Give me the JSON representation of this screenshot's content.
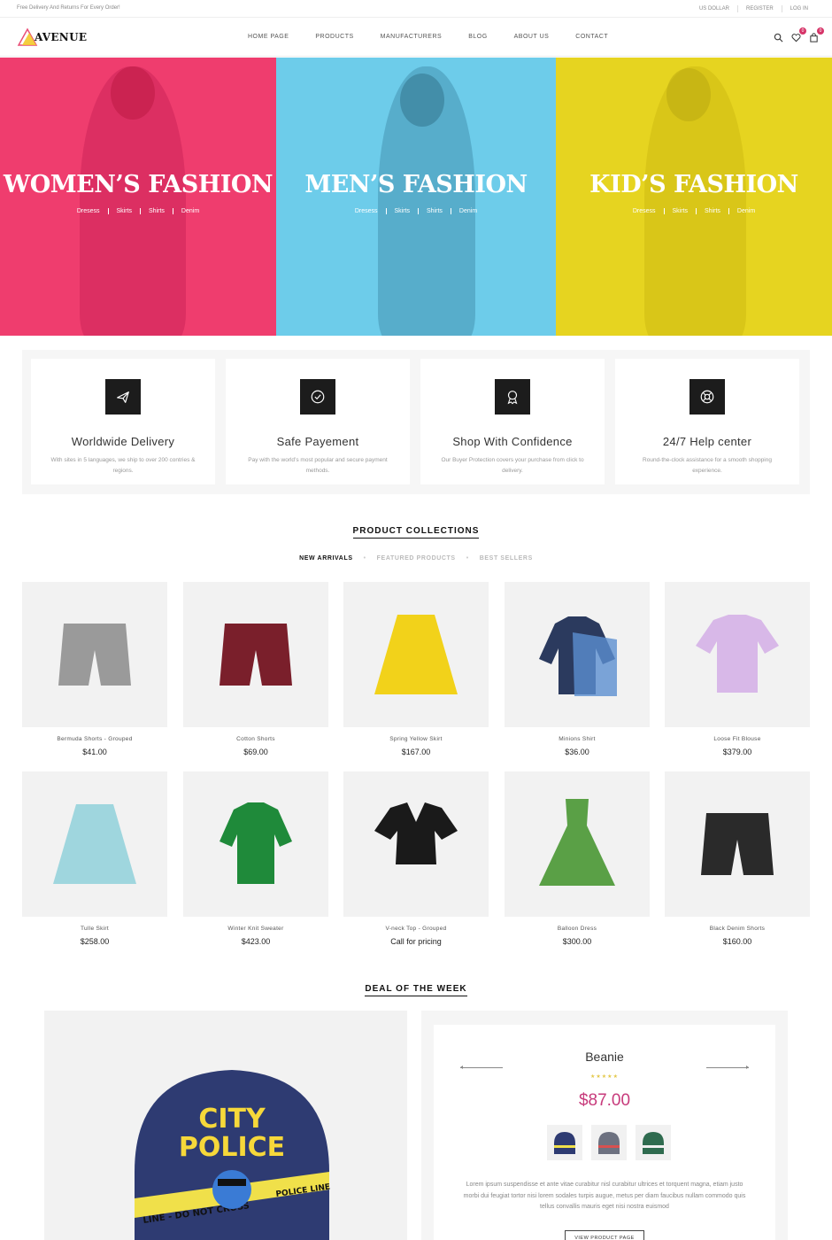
{
  "topbar": {
    "promo": "Free Delivery And Returns For Every Order!",
    "currency": "US DOLLAR",
    "register": "REGISTER",
    "login": "LOG IN"
  },
  "header": {
    "brand": "AVENUE",
    "nav": [
      "HOME PAGE",
      "PRODUCTS",
      "MANUFACTURERS",
      "BLOG",
      "ABOUT US",
      "CONTACT"
    ],
    "wishlist_count": "0",
    "cart_count": "0",
    "icons": [
      "search-icon",
      "heart-icon",
      "bag-icon"
    ]
  },
  "hero": [
    {
      "title": "WOMEN’S FASHION",
      "links": [
        "Dresess",
        "Skirts",
        "Shirts",
        "Denim"
      ],
      "color": "#ef3d6e"
    },
    {
      "title": "MEN’S FASHION",
      "links": [
        "Dresess",
        "Skirts",
        "Shirts",
        "Denim"
      ],
      "color": "#6dccea"
    },
    {
      "title": "KID’S FASHION",
      "links": [
        "Dresess",
        "Skirts",
        "Shirts",
        "Denim"
      ],
      "color": "#e6d420"
    }
  ],
  "features": [
    {
      "title": "Worldwide Delivery",
      "desc": "With sites in 5 languages, we ship to over 200 contries & regions.",
      "icon": "plane-icon"
    },
    {
      "title": "Safe Payement",
      "desc": "Pay with the world’s most popular and secure payment methods.",
      "icon": "check-circle-icon"
    },
    {
      "title": "Shop With Confidence",
      "desc": "Our Buyer Protection covers your purchase from click to delivery.",
      "icon": "award-icon"
    },
    {
      "title": "24/7 Help center",
      "desc": "Round-the-clock assistance for a smooth shopping experience.",
      "icon": "lifebuoy-icon"
    }
  ],
  "collections": {
    "title": "PRODUCT COLLECTIONS",
    "tabs": [
      "NEW ARRIVALS",
      "FEATURED PRODUCTS",
      "BEST SELLERS"
    ],
    "active_tab": "NEW ARRIVALS",
    "products": [
      {
        "name": "Bermuda Shorts - Grouped",
        "price": "$41.00",
        "icon": "shorts-icon",
        "color": "#9a9a9a"
      },
      {
        "name": "Cotton Shorts",
        "price": "$69.00",
        "icon": "shorts-icon",
        "color": "#7a1f2b"
      },
      {
        "name": "Spring Yellow Skirt",
        "price": "$167.00",
        "icon": "skirt-icon",
        "color": "#f2d21a"
      },
      {
        "name": "Minions Shirt",
        "price": "$36.00",
        "icon": "shirt-icon",
        "color": "#2b3a5e"
      },
      {
        "name": "Loose Fit Blouse",
        "price": "$379.00",
        "icon": "blouse-icon",
        "color": "#d8b8e8"
      },
      {
        "name": "Tulle Skirt",
        "price": "$258.00",
        "icon": "skirt-icon",
        "color": "#9fd6de"
      },
      {
        "name": "Winter Knit Sweater",
        "price": "$423.00",
        "icon": "polo-icon",
        "color": "#1f8a3a"
      },
      {
        "name": "V-neck Top - Grouped",
        "price": "Call for pricing",
        "icon": "top-icon",
        "color": "#1a1a1a"
      },
      {
        "name": "Balloon Dress",
        "price": "$300.00",
        "icon": "dress-icon",
        "color": "#5aa046"
      },
      {
        "name": "Black Denim Shorts",
        "price": "$160.00",
        "icon": "shorts-icon",
        "color": "#2a2a2a"
      }
    ]
  },
  "deal": {
    "title": "DEAL OF THE WEEK",
    "product_name": "Beanie",
    "rating": "★★★★★",
    "price": "$87.00",
    "description": "Lorem ipsum suspendisse et ante vitae curabitur nisl curabitur ultrices et torquent magna, etiam justo morbi dui feugiat tortor nisi lorem sodales turpis augue, metus per diam faucibus nullam commodo quis tellus convallis mauris eget nisi nostra euismod",
    "button": "VIEW PRODUCT PAGE",
    "image_text": "CITY POLICE",
    "tape_text": [
      "LINE - DO NOT CROSS",
      "POLICE LINE"
    ],
    "thumbs": [
      "beanie-thumb-navy",
      "beanie-thumb-grey",
      "beanie-thumb-green"
    ]
  }
}
